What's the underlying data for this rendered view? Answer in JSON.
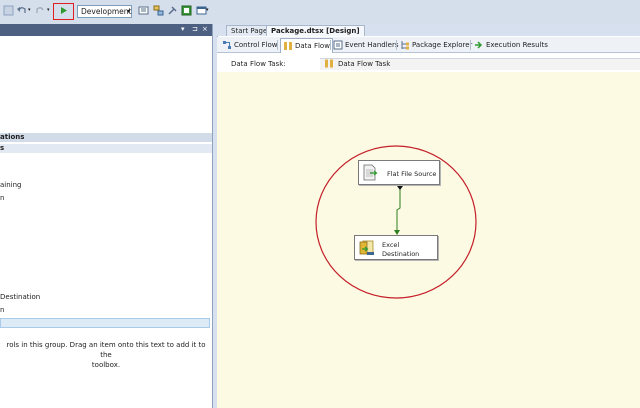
{
  "toolbar": {
    "configuration": "Development",
    "icons": [
      "undo-icon",
      "redo-icon",
      "start-debugging-icon",
      "properties-icon",
      "solution-explorer-icon",
      "toolbox-icon",
      "error-list-icon",
      "window-icon"
    ]
  },
  "toolbox": {
    "group_header_1": "ations",
    "group_header_2": "s",
    "items": [
      "aining",
      "n",
      "Destination",
      "n"
    ],
    "empty_hint_line1": "rols in this group. Drag an item onto this text to add it to the",
    "empty_hint_line2": "toolbox."
  },
  "document_tabs": {
    "start_page": "Start Page",
    "package": "Package.dtsx [Design]"
  },
  "designer_tabs": {
    "control_flow": "Control Flow",
    "data_flow": "Data Flow",
    "event_handlers": "Event Handlers",
    "package_explorer": "Package Explorer",
    "execution_results": "Execution Results"
  },
  "data_flow": {
    "task_label": "Data Flow Task:",
    "task_value": "Data Flow Task"
  },
  "components": {
    "source": "Flat File Source",
    "destination_line1": "Excel",
    "destination_line2": "Destination"
  },
  "colors": {
    "highlight_ring": "#c41e2a",
    "path_arrow": "#2e7d1e",
    "canvas_bg": "#fcfae2"
  }
}
